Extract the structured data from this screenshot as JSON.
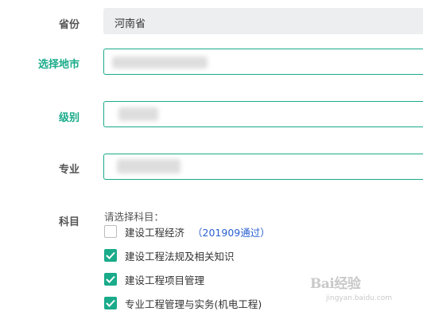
{
  "form": {
    "province": {
      "label": "省份",
      "value": "河南省"
    },
    "city": {
      "label": "选择地市",
      "value": ""
    },
    "level": {
      "label": "级别",
      "value": ""
    },
    "major": {
      "label": "专业",
      "value": ""
    },
    "subjects": {
      "label": "科目",
      "hint": "请选择科目：",
      "items": [
        {
          "name": "建设工程经济",
          "checked": false,
          "note": "（201909通过）"
        },
        {
          "name": "建设工程法规及相关知识",
          "checked": true,
          "note": ""
        },
        {
          "name": "建设工程项目管理",
          "checked": true,
          "note": ""
        },
        {
          "name": "专业工程管理与实务(机电工程)",
          "checked": true,
          "note": ""
        }
      ]
    }
  },
  "colors": {
    "accent": "#1aab8a",
    "label": "#555555",
    "disabled_bg": "#eceeef",
    "note_link": "#2a5fd0"
  },
  "watermark": {
    "brand": "Bai经验",
    "url": "jingyan.baidu.com"
  }
}
